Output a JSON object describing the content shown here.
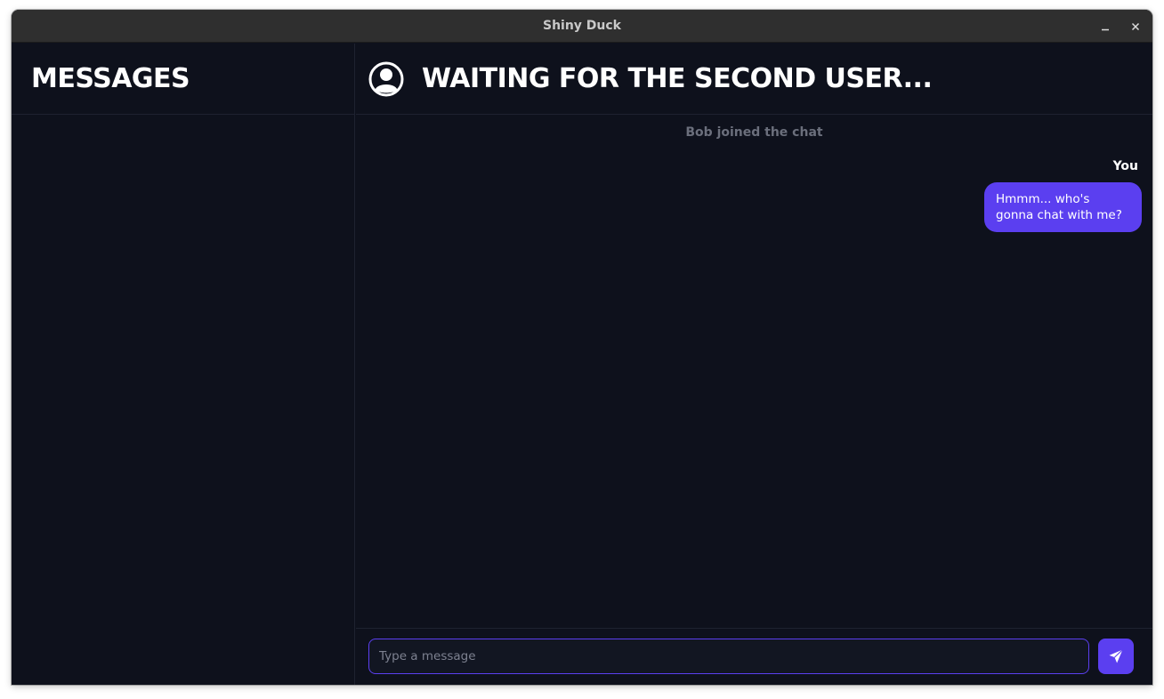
{
  "window": {
    "title": "Shiny Duck",
    "minimize_icon": "minimize-icon",
    "close_icon": "close-icon"
  },
  "sidebar": {
    "title": "MESSAGES",
    "conversations": []
  },
  "chat": {
    "avatar_icon": "user-avatar-icon",
    "title": "WAITING FOR THE SECOND USER...",
    "system_message": "Bob joined the chat",
    "messages": [
      {
        "sender": "You",
        "text": "Hmmm... who's gonna chat with me?"
      }
    ]
  },
  "composer": {
    "placeholder": "Type a message",
    "value": "",
    "send_icon": "send-icon"
  },
  "colors": {
    "accent": "#5b3ff0",
    "background": "#0e111c",
    "titlebar": "#2f2f2f",
    "muted_text": "#6b6f7c"
  }
}
